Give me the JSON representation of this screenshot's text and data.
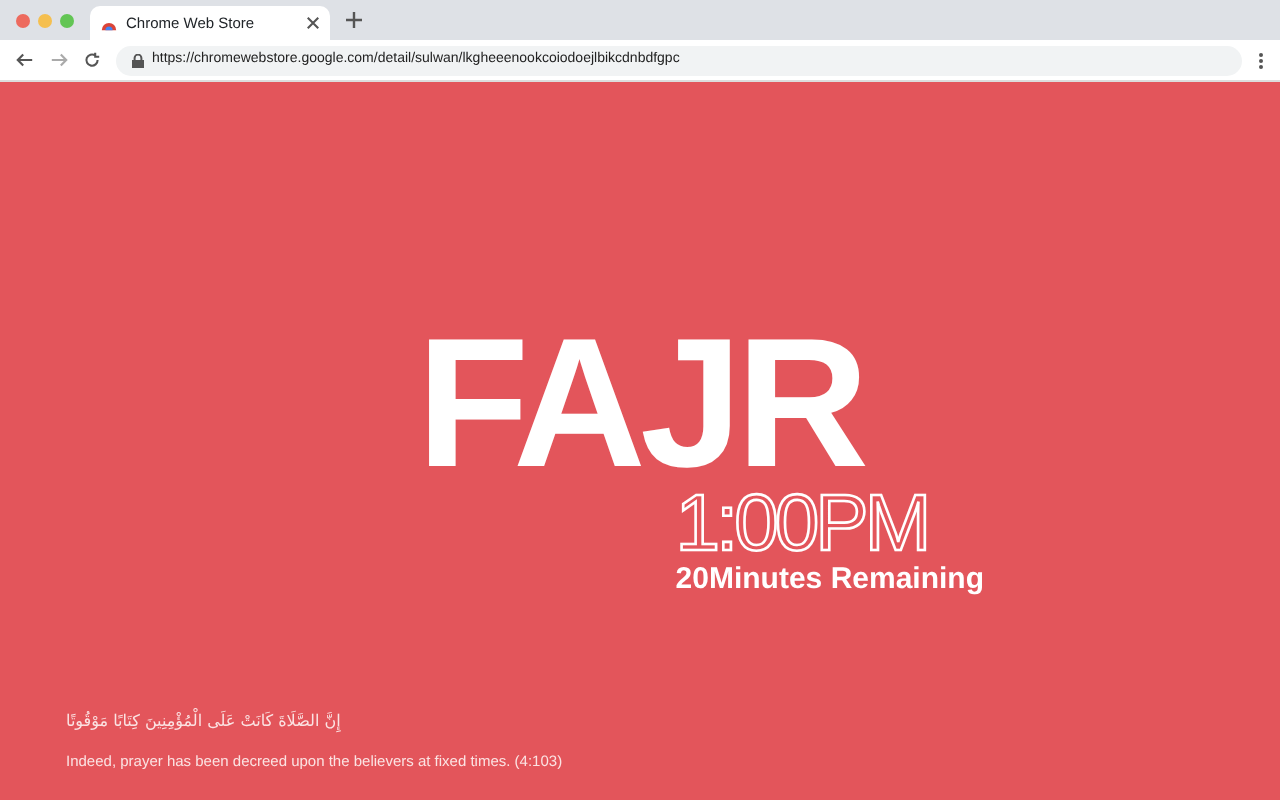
{
  "browser": {
    "tab_title": "Chrome Web Store",
    "url": "https://chromewebstore.google.com/detail/sulwan/lkgheeenookcoiodoejlbikcdnbdfgpc"
  },
  "prayer": {
    "name": "FAJR",
    "time": "1:00PM",
    "remaining": "20Minutes Remaining"
  },
  "verse": {
    "arabic": "إِنَّ الصَّلَاةَ كَانَتْ عَلَى الْمُؤْمِنِينَ كِتَابًا مَوْقُوتًا",
    "translation": "Indeed, prayer has been decreed upon the believers at fixed times. (4:103)"
  }
}
